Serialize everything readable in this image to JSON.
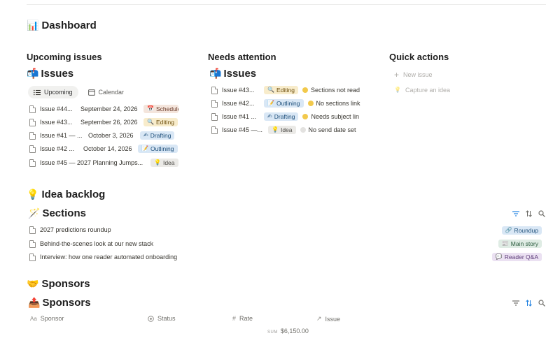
{
  "page": {
    "title": "Dashboard",
    "title_icon": "📊"
  },
  "upcoming": {
    "heading": "Upcoming issues",
    "db_icon": "📬",
    "db_title": "Issues",
    "tabs": [
      {
        "label": "Upcoming",
        "icon": "list-icon",
        "active": true
      },
      {
        "label": "Calendar",
        "icon": "calendar-icon",
        "active": false
      }
    ],
    "rows": [
      {
        "name": "Issue #44...",
        "date": "September 24, 2026",
        "status": "Schedule",
        "status_icon": "📅",
        "color": "brown"
      },
      {
        "name": "Issue #43...",
        "date": "September 26, 2026",
        "status": "Editing",
        "status_icon": "🔍",
        "color": "yellow"
      },
      {
        "name": "Issue #41 — ...",
        "date": "October 3, 2026",
        "status": "Drafting",
        "status_icon": "✍",
        "color": "blue"
      },
      {
        "name": "Issue #42 ...",
        "date": "October 14, 2026",
        "status": "Outlining",
        "status_icon": "📝",
        "color": "blue"
      },
      {
        "name": "Issue #45 — 2027 Planning Jumps...",
        "date": "",
        "status": "Idea",
        "status_icon": "💡",
        "color": "gray"
      }
    ]
  },
  "attention": {
    "heading": "Needs attention",
    "db_icon": "📬",
    "db_title": "Issues",
    "rows": [
      {
        "name": "Issue #43...",
        "status": "Editing",
        "status_icon": "🔍",
        "color": "yellow",
        "flag": "Sections not read",
        "flag_color": "#f2c94c"
      },
      {
        "name": "Issue #42...",
        "status": "Outlining",
        "status_icon": "📝",
        "color": "blue",
        "flag": "No sections link",
        "flag_color": "#f2c94c"
      },
      {
        "name": "Issue #41 ...",
        "status": "Drafting",
        "status_icon": "✍",
        "color": "blue",
        "flag": "Needs subject lin",
        "flag_color": "#f2c94c"
      },
      {
        "name": "Issue #45 —...",
        "status": "Idea",
        "status_icon": "💡",
        "color": "gray",
        "flag": "No send date set",
        "flag_color": "#e3e2e0"
      }
    ]
  },
  "quick_actions": {
    "heading": "Quick actions",
    "items": [
      {
        "label": "New issue",
        "icon": "plus-icon"
      },
      {
        "label": "Capture an idea",
        "icon": "bulb-icon"
      }
    ]
  },
  "idea_backlog": {
    "heading": "Idea backlog",
    "heading_icon": "💡",
    "db_icon": "🪄",
    "db_title": "Sections",
    "rows": [
      {
        "name": "2027 predictions roundup",
        "tag": "Roundup",
        "tag_icon": "🔗",
        "color": "blue"
      },
      {
        "name": "Behind-the-scenes look at our new stack",
        "tag": "Main story",
        "tag_icon": "📰",
        "color": "green"
      },
      {
        "name": "Interview: how one reader automated onboarding",
        "tag": "Reader Q&A",
        "tag_icon": "💬",
        "color": "purple"
      }
    ]
  },
  "sponsors": {
    "heading": "Sponsors",
    "heading_icon": "🤝",
    "db_icon": "📤",
    "db_title": "Sponsors",
    "columns": [
      {
        "label": "Sponsor",
        "icon": "Aa"
      },
      {
        "label": "Status",
        "icon": "status-icon"
      },
      {
        "label": "Rate",
        "icon": "#"
      },
      {
        "label": "Issue",
        "icon": "↗"
      }
    ],
    "sum_label": "SUM",
    "sum_value": "$6,150.00"
  },
  "colors": {
    "accent": "#2383e2",
    "text": "#37352f",
    "muted": "#9b9a97"
  }
}
